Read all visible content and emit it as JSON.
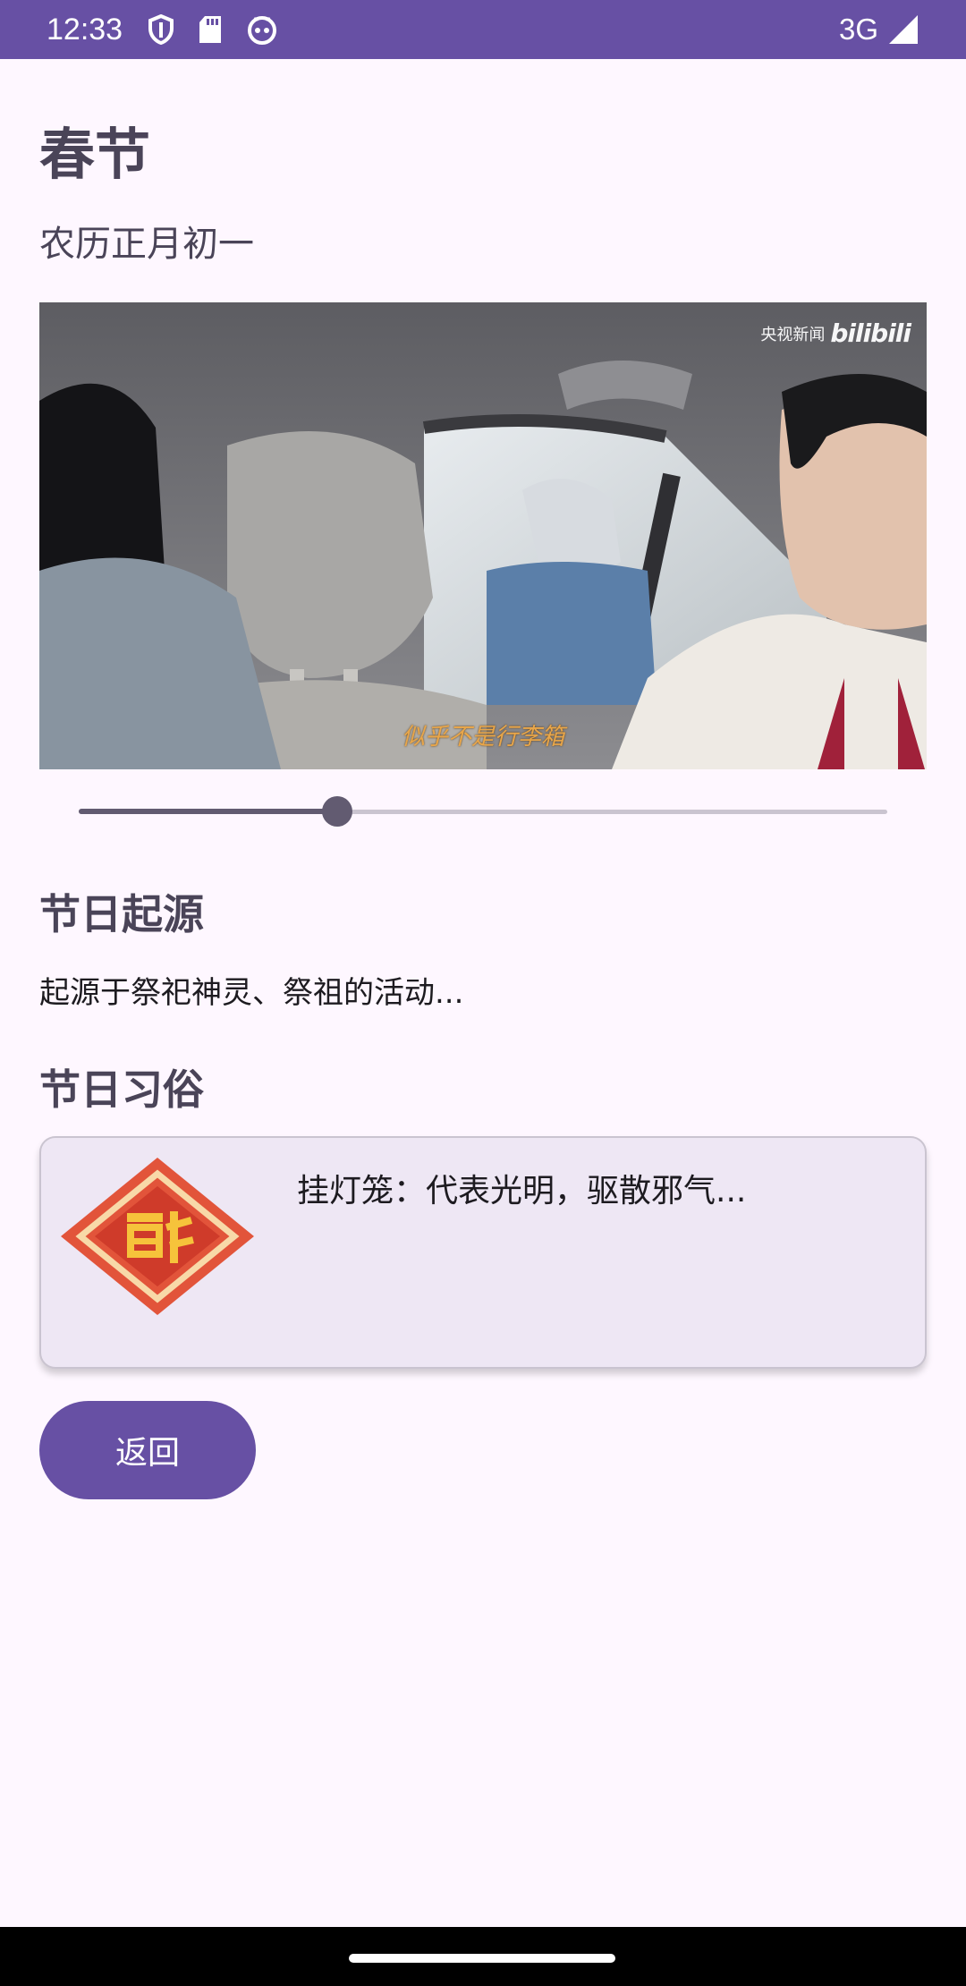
{
  "status_bar": {
    "time": "12:33",
    "network": "3G",
    "icons": [
      "shield-icon",
      "sd-card-icon",
      "cat-face-icon",
      "signal-icon"
    ],
    "color": "#6750A4"
  },
  "page": {
    "title": "春节",
    "subtitle": "农历正月初一"
  },
  "video": {
    "watermark_cn": "央视新闻",
    "watermark_brand": "bilibili",
    "caption": "似乎不是行李箱",
    "progress": 0.32
  },
  "origin": {
    "title": "节日起源",
    "text": "起源于祭祀神灵、祭祖的活动..."
  },
  "customs": {
    "title": "节日习俗",
    "card_icon": "fu-diamond-icon",
    "card_text": "挂灯笼：代表光明，驱散邪气..."
  },
  "actions": {
    "back_label": "返回"
  },
  "colors": {
    "primary": "#6750A4",
    "background": "#FEF7FF",
    "card": "#EEE7F4",
    "slider": "#625B71"
  }
}
